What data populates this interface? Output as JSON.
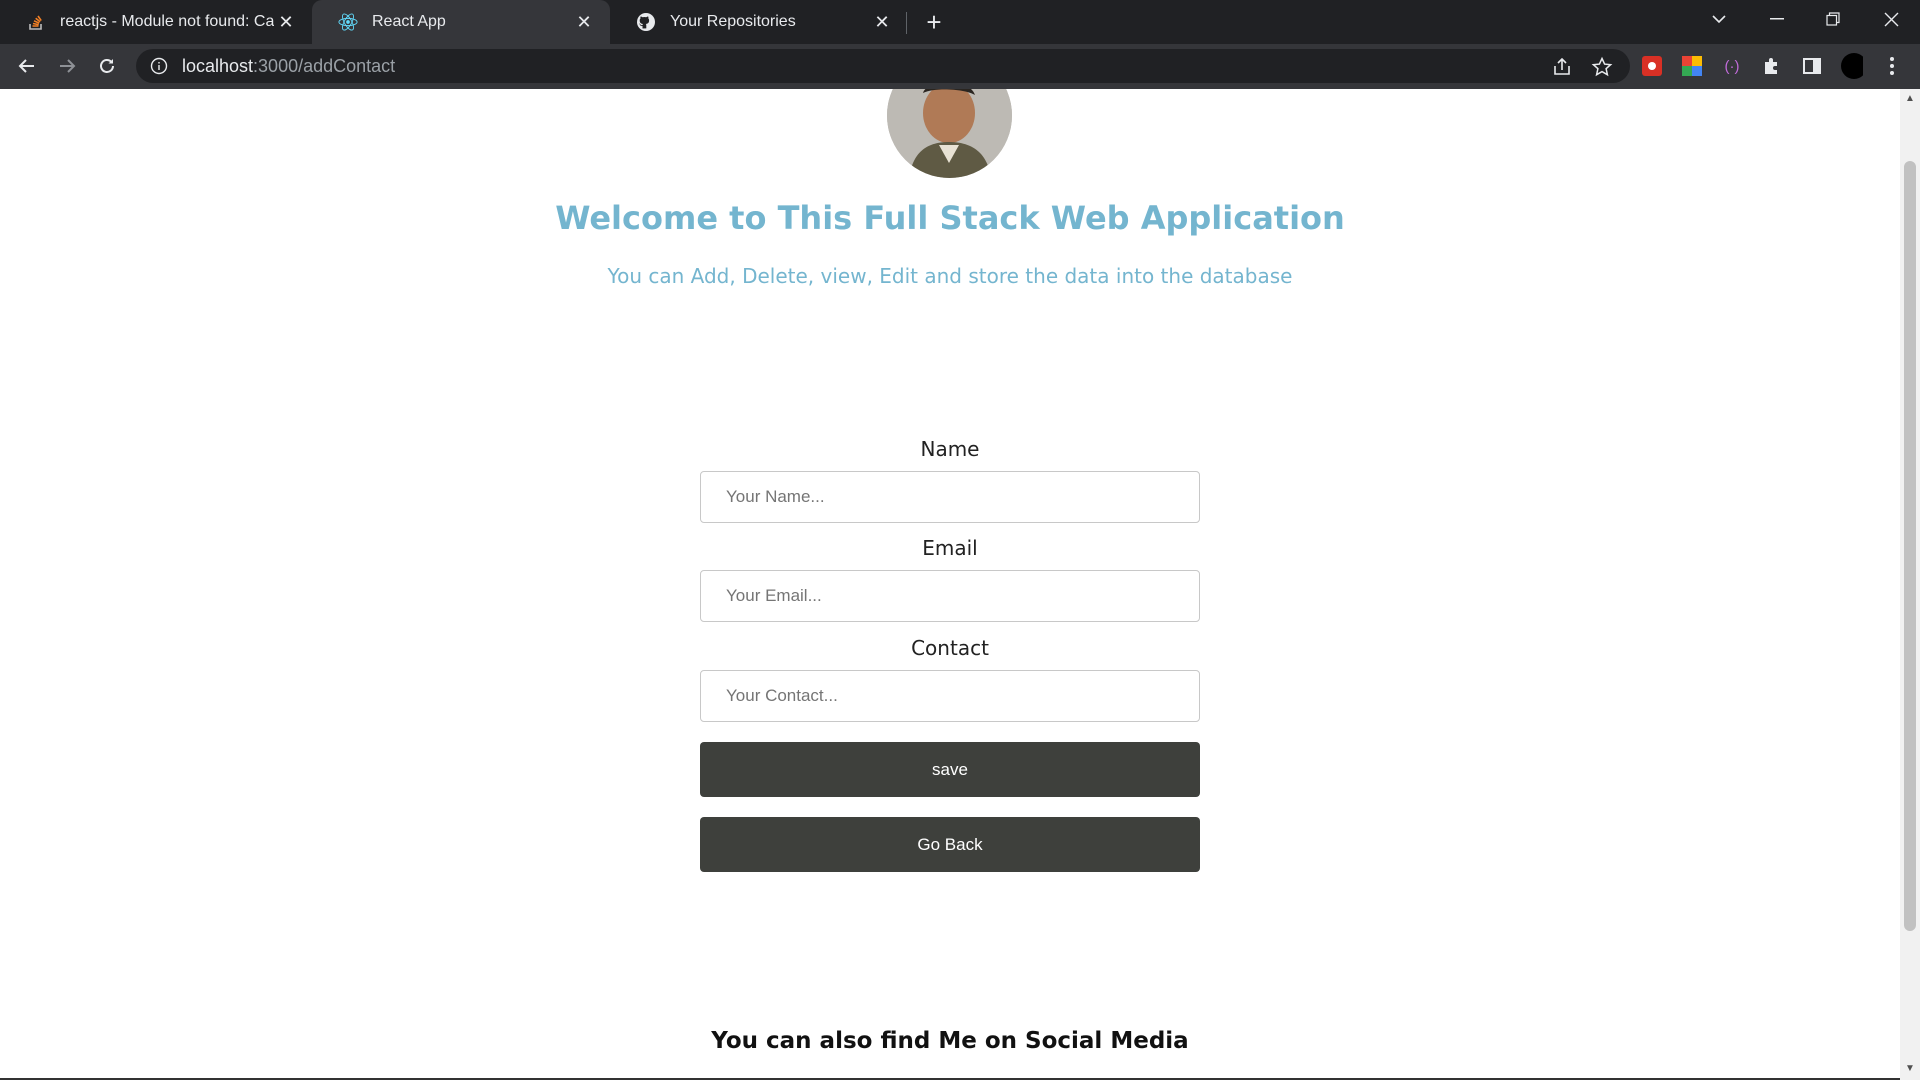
{
  "browser": {
    "tabs": [
      {
        "title": "reactjs - Module not found: Can't",
        "icon": "stackoverflow-icon",
        "active": false
      },
      {
        "title": "React App",
        "icon": "react-icon",
        "active": true
      },
      {
        "title": "Your Repositories",
        "icon": "github-icon",
        "active": false
      }
    ],
    "new_tab_label": "+",
    "url_host": "localhost",
    "url_path": ":3000/addContact"
  },
  "header": {
    "title": "Welcome to This Full Stack Web Application",
    "subtitle": "You can Add, Delete, view, Edit and store the data into the database"
  },
  "form": {
    "name_label": "Name",
    "name_placeholder": "Your Name...",
    "name_value": "",
    "email_label": "Email",
    "email_placeholder": "Your Email...",
    "email_value": "",
    "contact_label": "Contact",
    "contact_placeholder": "Your Contact...",
    "contact_value": "",
    "save_label": "save",
    "back_label": "Go Back"
  },
  "footer": {
    "social_title": "You can also find Me on Social Media"
  },
  "colors": {
    "accent": "#74b5cf",
    "button": "#3e403c",
    "chrome_dark": "#202124",
    "chrome_toolbar": "#35363a"
  }
}
